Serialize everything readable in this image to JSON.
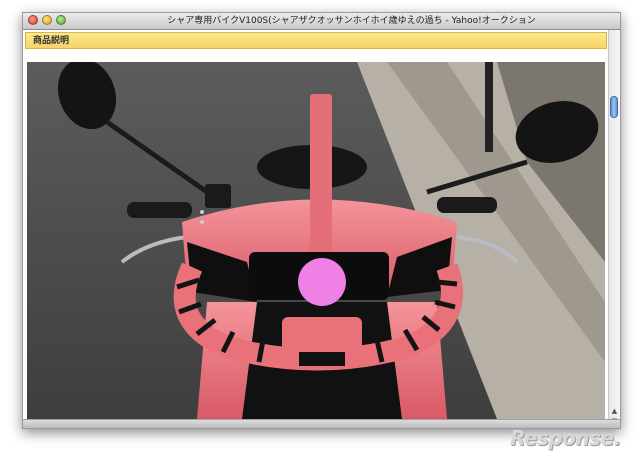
{
  "window": {
    "title": "シャア専用バイクV100S(シャアザクオッサンホイホイ歳ゆえの過ち - Yahoo!オークション"
  },
  "section": {
    "header": "商品説明"
  },
  "photo": {
    "subject": "pink-zaku-themed-scooter"
  },
  "watermark": {
    "text": "Response."
  },
  "colors": {
    "header_yellow": "#f6d36a",
    "scooter_pink": "#e8717a",
    "mono_eye": "#ee80e6"
  }
}
